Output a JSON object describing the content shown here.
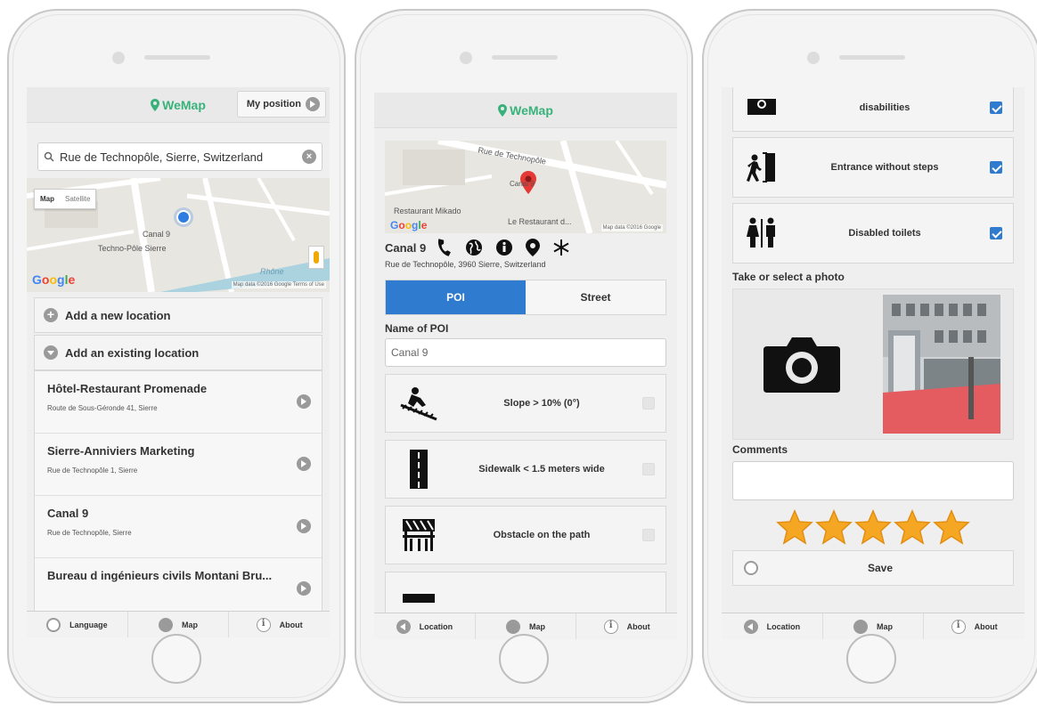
{
  "brand": {
    "name": "WeMap",
    "color": "#38b27a"
  },
  "accent": "#2f7bcf",
  "phone1": {
    "my_position_label": "My position",
    "search": {
      "value": "Rue de Technopôle, Sierre, Switzerland"
    },
    "map": {
      "map_tab": "Map",
      "satellite_tab": "Satellite",
      "place_label": "Canal 9",
      "place_label2": "Techno-Pôle Sierre",
      "water_label": "Rhône",
      "copyright": "Map data ©2016 Google  Terms of Use",
      "google": "Google"
    },
    "add_new": "Add a new location",
    "add_existing": "Add an existing location",
    "locations": [
      {
        "name": "Hôtel-Restaurant Promenade",
        "address": "Route de Sous-Géronde 41, Sierre"
      },
      {
        "name": "Sierre-Anniviers Marketing",
        "address": "Rue de Technopôle 1, Sierre"
      },
      {
        "name": "Canal 9",
        "address": "Rue de Technopôle, Sierre"
      },
      {
        "name": "Bureau d ingénieurs civils Montani Bru...",
        "address": ""
      }
    ],
    "tabs": [
      "Language",
      "Map",
      "About"
    ]
  },
  "phone2": {
    "map": {
      "street_label": "Rue de Technopôle",
      "marker_label": "Canal 9",
      "restaurant1": "Restaurant Mikado",
      "restaurant2": "Le Restaurant d...",
      "copyright": "Map data ©2016 Google",
      "google": "Google"
    },
    "poi_name": "Canal 9",
    "poi_address": "Rue de Technopôle, 3960 Sierre, Switzerland",
    "segments": [
      "POI",
      "Street"
    ],
    "name_label": "Name of POI",
    "name_value": "Canal 9",
    "criteria": [
      {
        "label": "Slope > 10% (0°)",
        "checked": false,
        "icon": "slope-icon"
      },
      {
        "label": "Sidewalk < 1.5 meters wide",
        "checked": false,
        "icon": "sidewalk-icon"
      },
      {
        "label": "Obstacle on the path",
        "checked": false,
        "icon": "obstacle-icon"
      }
    ],
    "tabs": [
      "Location",
      "Map",
      "About"
    ]
  },
  "phone3": {
    "criteria": [
      {
        "label": "disabilities",
        "checked": true,
        "icon": "parking-icon"
      },
      {
        "label": "Entrance without steps",
        "checked": true,
        "icon": "entrance-icon"
      },
      {
        "label": "Disabled toilets",
        "checked": true,
        "icon": "toilets-icon"
      }
    ],
    "photo_label": "Take or select a photo",
    "comments_label": "Comments",
    "rating": 5,
    "rating_max": 5,
    "save_label": "Save",
    "tabs": [
      "Location",
      "Map",
      "About"
    ]
  }
}
